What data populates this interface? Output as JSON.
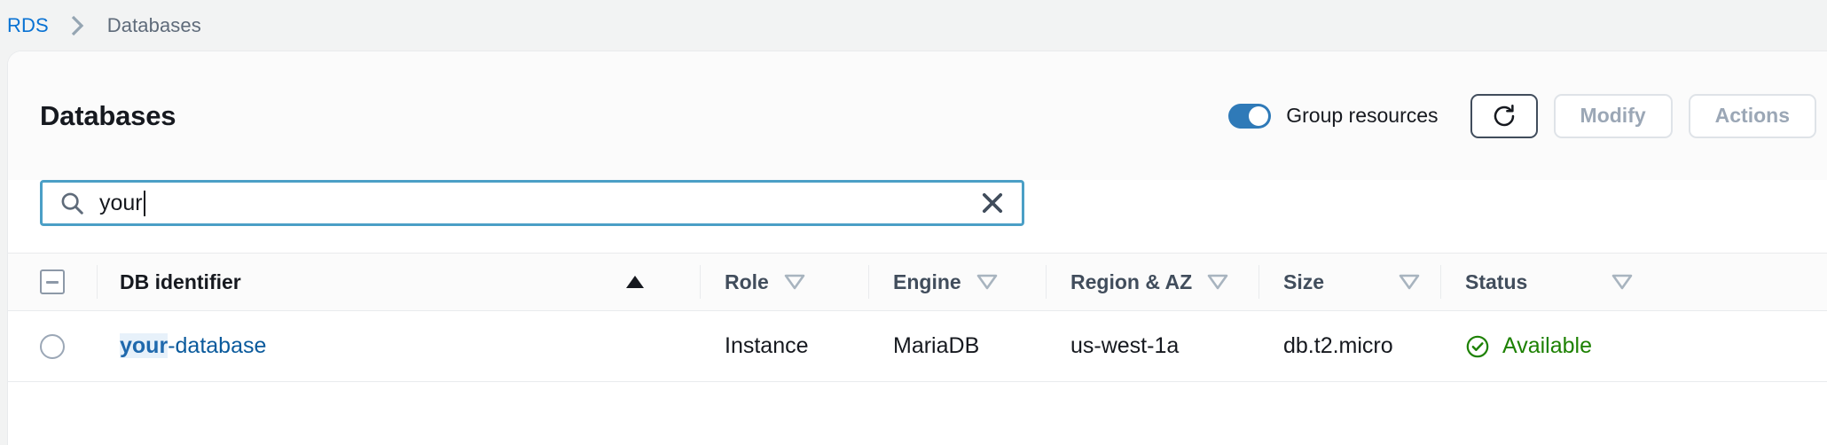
{
  "breadcrumb": {
    "root": "RDS",
    "separator_icon": "chevron-right-icon",
    "current": "Databases"
  },
  "header": {
    "title": "Databases",
    "group_resources": {
      "label": "Group resources",
      "enabled": true
    },
    "buttons": {
      "refresh_icon": "refresh-icon",
      "modify_label": "Modify",
      "modify_disabled": true,
      "actions_label": "Actions",
      "actions_disabled": true
    }
  },
  "search": {
    "icon": "search-icon",
    "value": "your",
    "placeholder": "Filter databases",
    "clear_icon": "close-icon",
    "focused": true
  },
  "table": {
    "select_all_state": "indeterminate",
    "columns": [
      {
        "key": "db_identifier",
        "label": "DB identifier",
        "sort": "asc",
        "sort_active": true
      },
      {
        "key": "role",
        "label": "Role",
        "sort": "desc",
        "sort_active": false
      },
      {
        "key": "engine",
        "label": "Engine",
        "sort": "desc",
        "sort_active": false
      },
      {
        "key": "region_az",
        "label": "Region & AZ",
        "sort": "desc",
        "sort_active": false
      },
      {
        "key": "size",
        "label": "Size",
        "sort": "desc",
        "sort_active": false
      },
      {
        "key": "status",
        "label": "Status",
        "sort": "desc",
        "sort_active": false
      }
    ],
    "rows": [
      {
        "selected": false,
        "db_identifier": "your-database",
        "db_identifier_match": "your",
        "db_identifier_rest": "-database",
        "role": "Instance",
        "engine": "MariaDB",
        "region_az": "us-west-1a",
        "size": "db.t2.micro",
        "status": "Available",
        "status_icon": "check-circle-icon"
      }
    ]
  },
  "colors": {
    "link": "#0972d3",
    "db_link": "#0a5a9c",
    "toggle_on": "#2f7ab8",
    "status_green": "#1d8102",
    "focus_border": "#4b9fc6",
    "disabled_text": "#9ba7b6",
    "page_bg": "#f2f3f3",
    "header_bg": "#fbfbfb"
  }
}
